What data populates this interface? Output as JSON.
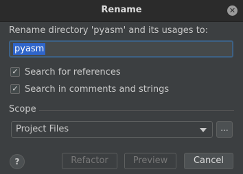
{
  "dialog": {
    "title": "Rename",
    "close_icon": "close-icon",
    "prompt": "Rename directory 'pyasm' and its usages to:",
    "name_value": "pyasm",
    "options": [
      {
        "label": "Search for references",
        "checked": true
      },
      {
        "label": "Search in comments and strings",
        "checked": true
      }
    ],
    "scope_label": "Scope",
    "scope_value": "Project Files",
    "browse_label": "...",
    "help_label": "?",
    "buttons": {
      "refactor": "Refactor",
      "preview": "Preview",
      "cancel": "Cancel"
    },
    "colors": {
      "background": "#3c3f41",
      "selection": "#2f65ca",
      "focus_border": "#3d6185"
    }
  }
}
